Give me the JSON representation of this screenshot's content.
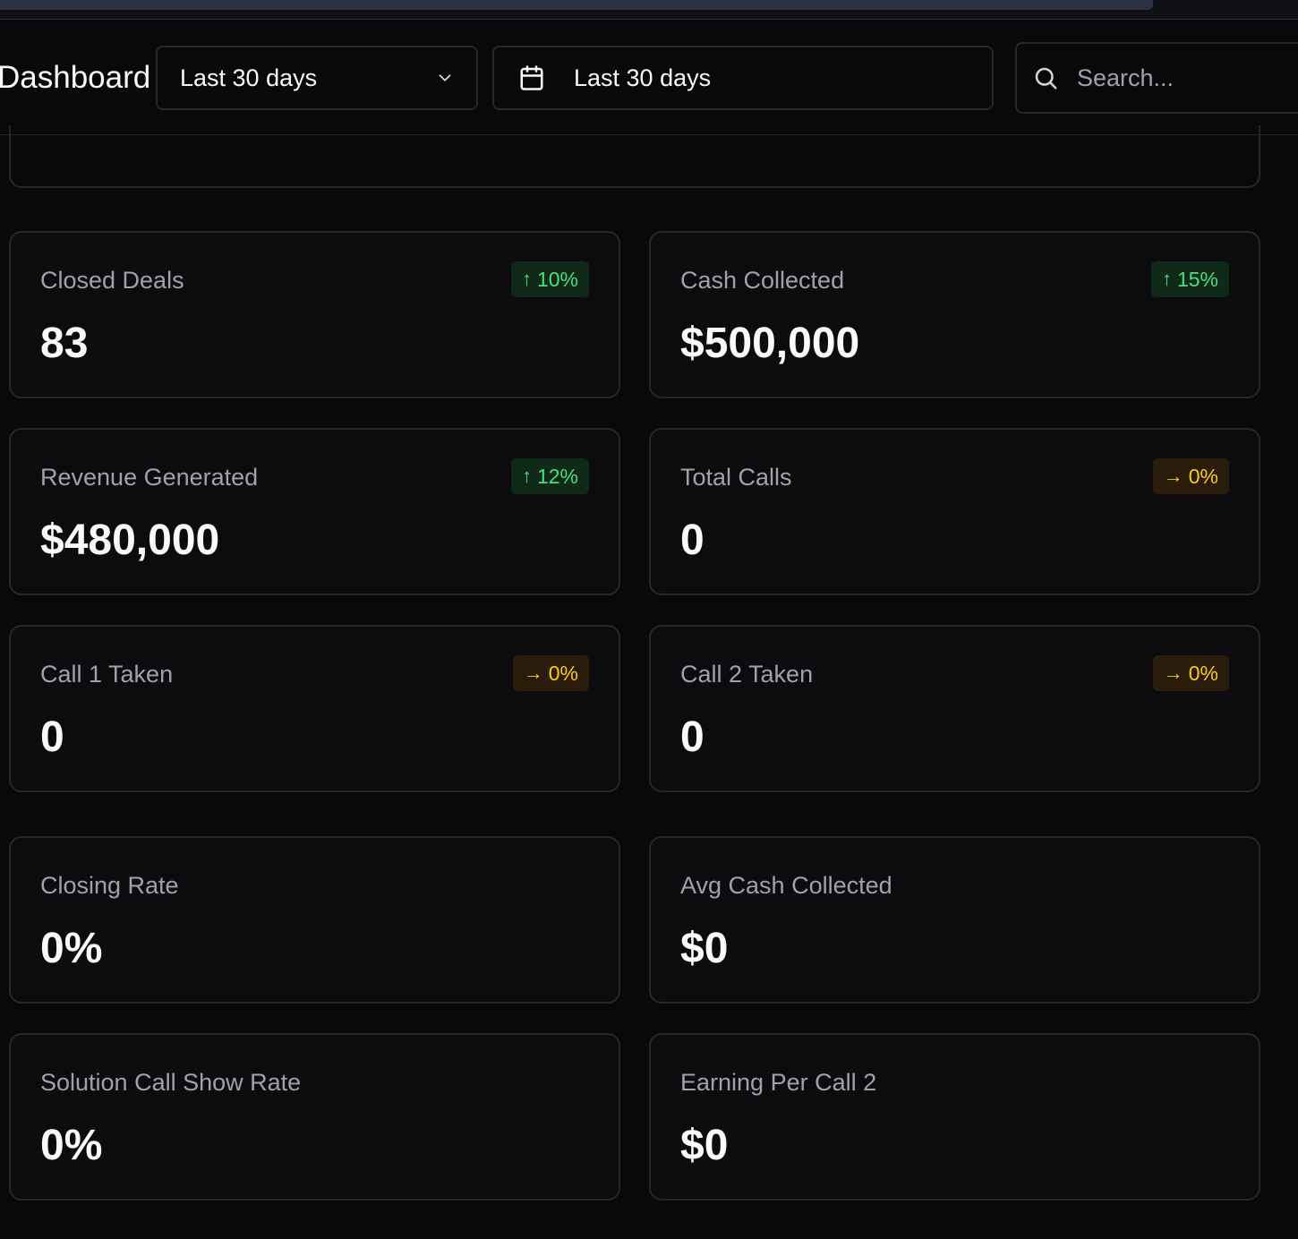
{
  "header": {
    "title": "Dashboard",
    "range_select": {
      "value": "Last 30 days",
      "icon": "chevron-down-icon"
    },
    "date_picker": {
      "value": "Last 30 days",
      "icon": "calendar-icon"
    },
    "search": {
      "placeholder": "Search...",
      "value": "",
      "icon": "search-icon"
    }
  },
  "colors": {
    "background": "#09090b",
    "card_border": "#27272a",
    "label": "#a1a1aa",
    "positive": "#4ade80",
    "neutral": "#facc15"
  },
  "metrics": [
    {
      "label": "Closed Deals",
      "value": "83",
      "badge": {
        "arrow": "↑",
        "text": "10%",
        "trend": "up"
      }
    },
    {
      "label": "Cash Collected",
      "value": "$500,000",
      "badge": {
        "arrow": "↑",
        "text": "15%",
        "trend": "up"
      }
    },
    {
      "label": "Revenue Generated",
      "value": "$480,000",
      "badge": {
        "arrow": "↑",
        "text": "12%",
        "trend": "up"
      }
    },
    {
      "label": "Total Calls",
      "value": "0",
      "badge": {
        "arrow": "→",
        "text": "0%",
        "trend": "flat"
      }
    },
    {
      "label": "Call 1 Taken",
      "value": "0",
      "badge": {
        "arrow": "→",
        "text": "0%",
        "trend": "flat"
      }
    },
    {
      "label": "Call 2 Taken",
      "value": "0",
      "badge": {
        "arrow": "→",
        "text": "0%",
        "trend": "flat"
      }
    },
    {
      "label": "Closing Rate",
      "value": "0%"
    },
    {
      "label": "Avg Cash Collected",
      "value": "$0"
    },
    {
      "label": "Solution Call Show Rate",
      "value": "0%"
    },
    {
      "label": "Earning Per Call 2",
      "value": "$0"
    }
  ]
}
